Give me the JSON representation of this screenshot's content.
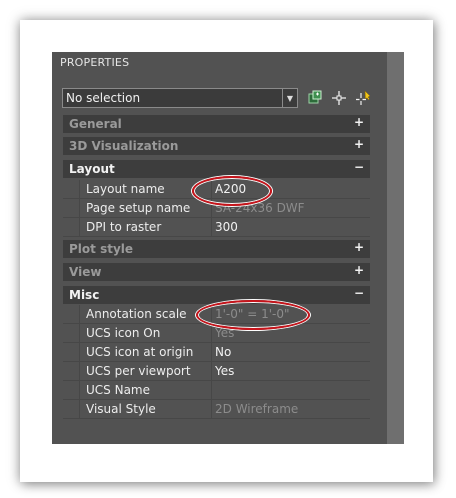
{
  "palette": {
    "title": "PROPERTIES",
    "selection": {
      "value": "No selection"
    },
    "toolbar": {
      "quick_select_icon": "quick-select-icon",
      "select_objects_icon": "select-objects-icon",
      "toggle_pickadd_icon": "toggle-pickadd-icon"
    },
    "sections": {
      "general": {
        "label": "General",
        "toggle": "+"
      },
      "visualization3d": {
        "label": "3D Visualization",
        "toggle": "+"
      },
      "layout": {
        "label": "Layout",
        "toggle": "−",
        "rows": [
          {
            "name": "Layout name",
            "value": "A200"
          },
          {
            "name": "Page setup name",
            "value": "SA-24x36 DWF"
          },
          {
            "name": "DPI to raster",
            "value": "300"
          }
        ]
      },
      "plot_style": {
        "label": "Plot style",
        "toggle": "+"
      },
      "view": {
        "label": "View",
        "toggle": "+"
      },
      "misc": {
        "label": "Misc",
        "toggle": "−",
        "rows": [
          {
            "name": "Annotation scale",
            "value": "1'-0\" = 1'-0\""
          },
          {
            "name": "UCS icon On",
            "value": "Yes"
          },
          {
            "name": "UCS icon at origin",
            "value": "No"
          },
          {
            "name": "UCS per viewport",
            "value": "Yes"
          },
          {
            "name": "UCS Name",
            "value": ""
          },
          {
            "name": "Visual Style",
            "value": "2D Wireframe"
          }
        ]
      }
    }
  },
  "colors": {
    "highlight_oval": "#c8141b",
    "panel_bg": "#525252"
  }
}
